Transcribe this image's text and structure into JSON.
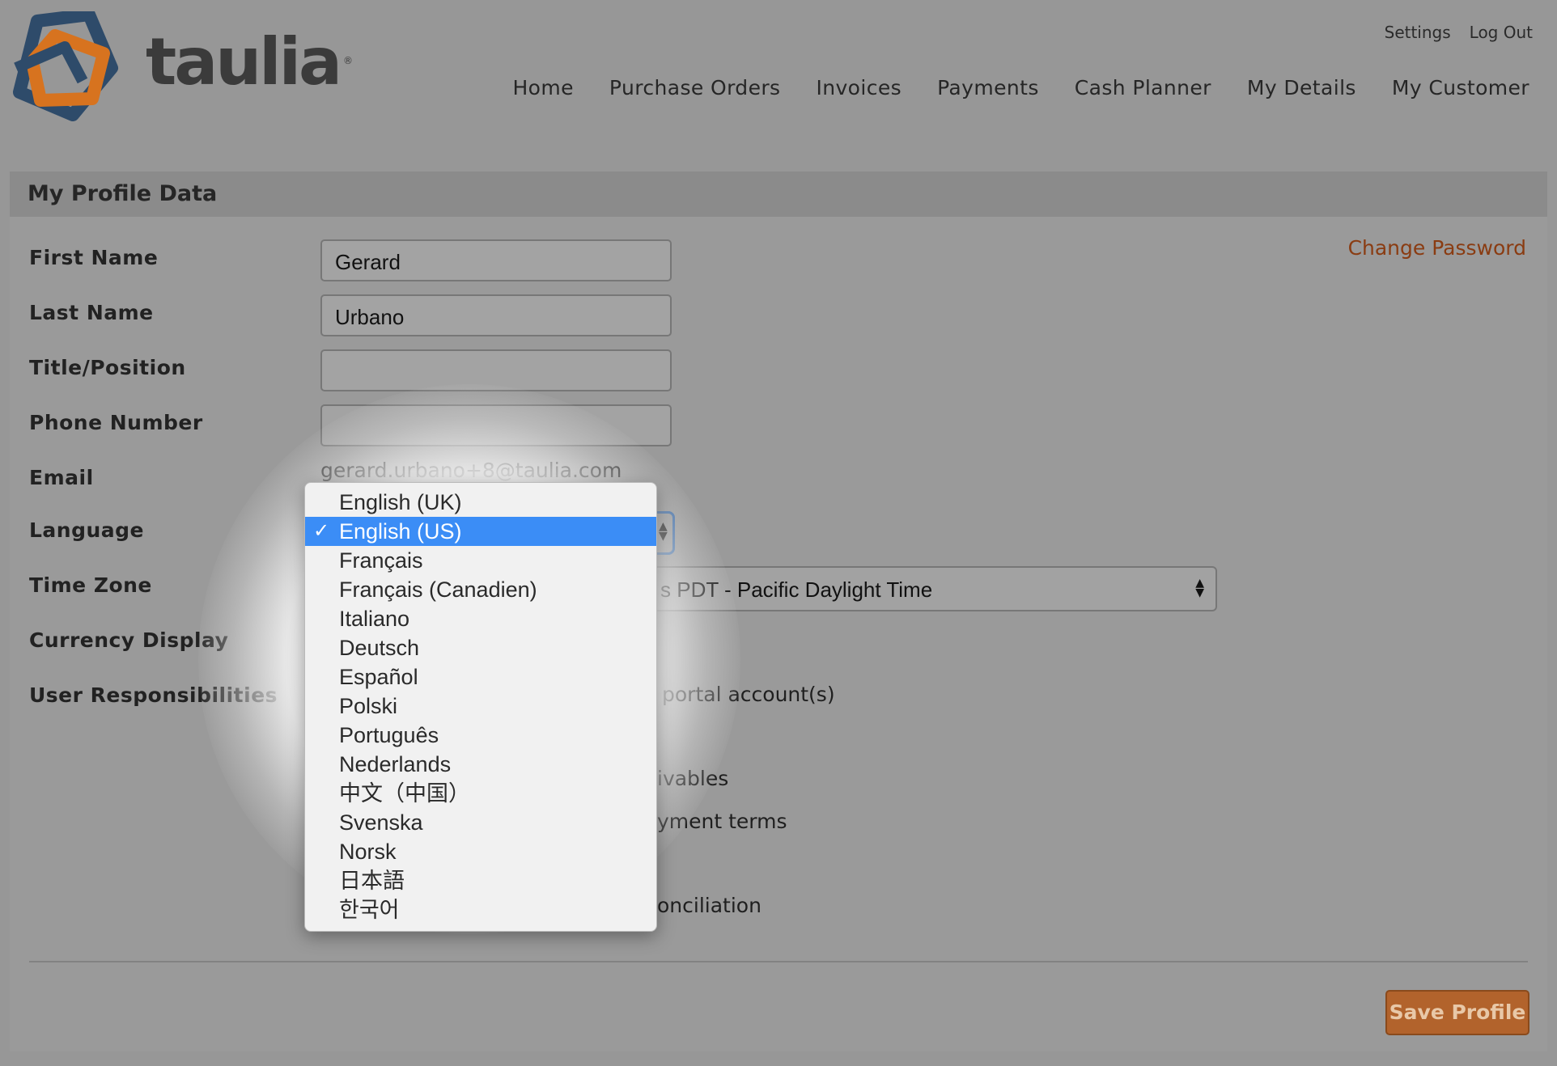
{
  "brand": {
    "name": "taulia",
    "trademark": "®",
    "colors": {
      "blue": "#2e4b6a",
      "orange": "#d7731f",
      "accent": "#8a3c12",
      "selection": "#3b8df6"
    }
  },
  "header": {
    "top_links": [
      "Settings",
      "Log Out"
    ],
    "nav": [
      "Home",
      "Purchase Orders",
      "Invoices",
      "Payments",
      "Cash Planner",
      "My Details",
      "My Customer"
    ]
  },
  "profile": {
    "title": "My Profile Data",
    "change_password": "Change Password",
    "labels": {
      "first_name": "First Name",
      "last_name": "Last Name",
      "title": "Title/Position",
      "phone": "Phone Number",
      "email": "Email",
      "language": "Language",
      "time_zone": "Time Zone",
      "currency": "Currency Display",
      "responsibilities": "User Responsibilities"
    },
    "values": {
      "first_name": "Gerard",
      "last_name": "Urbano",
      "title": "",
      "phone": "",
      "email": "gerard.urbano+8@taulia.com",
      "time_zone_visible": "s PDT - Pacific Daylight Time"
    },
    "responsibilities_visible": [
      "portal account(s)",
      "ivables",
      "yment terms",
      "onciliation"
    ],
    "save_button": "Save Profile"
  },
  "language_dropdown": {
    "selected": "English (US)",
    "check": "✓",
    "options": [
      "English (UK)",
      "English (US)",
      "Français",
      "Français (Canadien)",
      "Italiano",
      "Deutsch",
      "Español",
      "Polski",
      "Português",
      "Nederlands",
      "中文（中国）",
      "Svenska",
      "Norsk",
      "日本語",
      "한국어"
    ]
  },
  "icons": {
    "select_arrows": "▲▼",
    "logo": "taulia-logo-icon"
  }
}
